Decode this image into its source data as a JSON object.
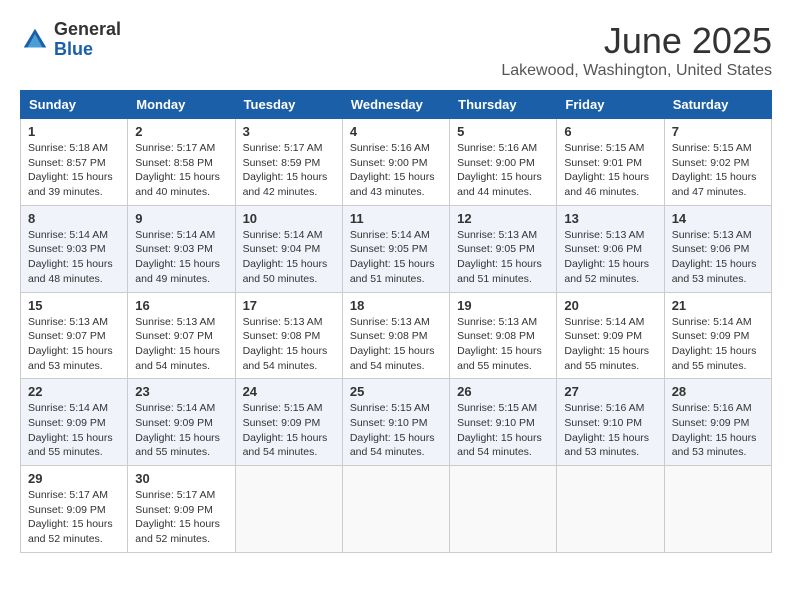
{
  "logo": {
    "general": "General",
    "blue": "Blue"
  },
  "title": "June 2025",
  "subtitle": "Lakewood, Washington, United States",
  "days_header": [
    "Sunday",
    "Monday",
    "Tuesday",
    "Wednesday",
    "Thursday",
    "Friday",
    "Saturday"
  ],
  "weeks": [
    [
      {
        "day": "1",
        "sunrise": "5:18 AM",
        "sunset": "8:57 PM",
        "daylight": "15 hours and 39 minutes."
      },
      {
        "day": "2",
        "sunrise": "5:17 AM",
        "sunset": "8:58 PM",
        "daylight": "15 hours and 40 minutes."
      },
      {
        "day": "3",
        "sunrise": "5:17 AM",
        "sunset": "8:59 PM",
        "daylight": "15 hours and 42 minutes."
      },
      {
        "day": "4",
        "sunrise": "5:16 AM",
        "sunset": "9:00 PM",
        "daylight": "15 hours and 43 minutes."
      },
      {
        "day": "5",
        "sunrise": "5:16 AM",
        "sunset": "9:00 PM",
        "daylight": "15 hours and 44 minutes."
      },
      {
        "day": "6",
        "sunrise": "5:15 AM",
        "sunset": "9:01 PM",
        "daylight": "15 hours and 46 minutes."
      },
      {
        "day": "7",
        "sunrise": "5:15 AM",
        "sunset": "9:02 PM",
        "daylight": "15 hours and 47 minutes."
      }
    ],
    [
      {
        "day": "8",
        "sunrise": "5:14 AM",
        "sunset": "9:03 PM",
        "daylight": "15 hours and 48 minutes."
      },
      {
        "day": "9",
        "sunrise": "5:14 AM",
        "sunset": "9:03 PM",
        "daylight": "15 hours and 49 minutes."
      },
      {
        "day": "10",
        "sunrise": "5:14 AM",
        "sunset": "9:04 PM",
        "daylight": "15 hours and 50 minutes."
      },
      {
        "day": "11",
        "sunrise": "5:14 AM",
        "sunset": "9:05 PM",
        "daylight": "15 hours and 51 minutes."
      },
      {
        "day": "12",
        "sunrise": "5:13 AM",
        "sunset": "9:05 PM",
        "daylight": "15 hours and 51 minutes."
      },
      {
        "day": "13",
        "sunrise": "5:13 AM",
        "sunset": "9:06 PM",
        "daylight": "15 hours and 52 minutes."
      },
      {
        "day": "14",
        "sunrise": "5:13 AM",
        "sunset": "9:06 PM",
        "daylight": "15 hours and 53 minutes."
      }
    ],
    [
      {
        "day": "15",
        "sunrise": "5:13 AM",
        "sunset": "9:07 PM",
        "daylight": "15 hours and 53 minutes."
      },
      {
        "day": "16",
        "sunrise": "5:13 AM",
        "sunset": "9:07 PM",
        "daylight": "15 hours and 54 minutes."
      },
      {
        "day": "17",
        "sunrise": "5:13 AM",
        "sunset": "9:08 PM",
        "daylight": "15 hours and 54 minutes."
      },
      {
        "day": "18",
        "sunrise": "5:13 AM",
        "sunset": "9:08 PM",
        "daylight": "15 hours and 54 minutes."
      },
      {
        "day": "19",
        "sunrise": "5:13 AM",
        "sunset": "9:08 PM",
        "daylight": "15 hours and 55 minutes."
      },
      {
        "day": "20",
        "sunrise": "5:14 AM",
        "sunset": "9:09 PM",
        "daylight": "15 hours and 55 minutes."
      },
      {
        "day": "21",
        "sunrise": "5:14 AM",
        "sunset": "9:09 PM",
        "daylight": "15 hours and 55 minutes."
      }
    ],
    [
      {
        "day": "22",
        "sunrise": "5:14 AM",
        "sunset": "9:09 PM",
        "daylight": "15 hours and 55 minutes."
      },
      {
        "day": "23",
        "sunrise": "5:14 AM",
        "sunset": "9:09 PM",
        "daylight": "15 hours and 55 minutes."
      },
      {
        "day": "24",
        "sunrise": "5:15 AM",
        "sunset": "9:09 PM",
        "daylight": "15 hours and 54 minutes."
      },
      {
        "day": "25",
        "sunrise": "5:15 AM",
        "sunset": "9:10 PM",
        "daylight": "15 hours and 54 minutes."
      },
      {
        "day": "26",
        "sunrise": "5:15 AM",
        "sunset": "9:10 PM",
        "daylight": "15 hours and 54 minutes."
      },
      {
        "day": "27",
        "sunrise": "5:16 AM",
        "sunset": "9:10 PM",
        "daylight": "15 hours and 53 minutes."
      },
      {
        "day": "28",
        "sunrise": "5:16 AM",
        "sunset": "9:09 PM",
        "daylight": "15 hours and 53 minutes."
      }
    ],
    [
      {
        "day": "29",
        "sunrise": "5:17 AM",
        "sunset": "9:09 PM",
        "daylight": "15 hours and 52 minutes."
      },
      {
        "day": "30",
        "sunrise": "5:17 AM",
        "sunset": "9:09 PM",
        "daylight": "15 hours and 52 minutes."
      },
      null,
      null,
      null,
      null,
      null
    ]
  ]
}
